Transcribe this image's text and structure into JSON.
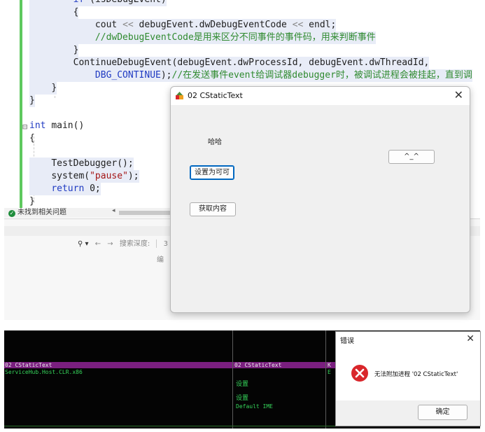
{
  "editor": {
    "lines": [
      {
        "indent": "        ",
        "parts": [
          {
            "t": "if ",
            "c": "kw"
          },
          {
            "t": "(",
            "c": "pl"
          },
          {
            "t": "isDebugEvent",
            "c": "pl"
          },
          {
            "t": ")",
            "c": "pl"
          }
        ]
      },
      {
        "indent": "        ",
        "parts": [
          {
            "t": "{",
            "c": "pl"
          }
        ]
      },
      {
        "indent": "            ",
        "parts": [
          {
            "t": "cout ",
            "c": "pl"
          },
          {
            "t": "<<",
            "c": "dim"
          },
          {
            "t": " debugEvent.dwDebugEventCode ",
            "c": "pl"
          },
          {
            "t": "<<",
            "c": "dim"
          },
          {
            "t": " endl;",
            "c": "pl"
          }
        ]
      },
      {
        "indent": "            ",
        "parts": [
          {
            "t": "//dwDebugEventCode是用来区分不同事件的事件码，用来判断事件",
            "c": "cm"
          }
        ]
      },
      {
        "indent": "        ",
        "parts": [
          {
            "t": "}",
            "c": "pl"
          }
        ]
      },
      {
        "indent": "        ",
        "parts": [
          {
            "t": "ContinueDebugEvent(debugEvent.dwProcessId, debugEvent.dwThreadId,",
            "c": "pl"
          }
        ]
      },
      {
        "indent": "            ",
        "parts": [
          {
            "t": "DBG_CONTINUE",
            "c": "kw"
          },
          {
            "t": ");",
            "c": "pl"
          },
          {
            "t": "//在发送事件event给调试器debugger时，被调试进程会被挂起，直到调",
            "c": "cm"
          }
        ]
      },
      {
        "indent": "    ",
        "parts": [
          {
            "t": "}",
            "c": "pl"
          }
        ]
      },
      {
        "indent": "",
        "parts": [
          {
            "t": "}",
            "c": "pl"
          }
        ]
      },
      {
        "indent": "",
        "parts": []
      },
      {
        "indent": "",
        "parts": [
          {
            "t": "int ",
            "c": "kw"
          },
          {
            "t": "main()",
            "c": "pl"
          }
        ]
      },
      {
        "indent": "",
        "parts": [
          {
            "t": "{",
            "c": "pl"
          }
        ]
      },
      {
        "indent": "",
        "parts": []
      },
      {
        "indent": "    ",
        "parts": [
          {
            "t": "TestDebugger();",
            "c": "pl"
          }
        ]
      },
      {
        "indent": "    ",
        "parts": [
          {
            "t": "system(",
            "c": "pl"
          },
          {
            "t": "\"pause\"",
            "c": "str"
          },
          {
            "t": ");",
            "c": "pl"
          }
        ]
      },
      {
        "indent": "    ",
        "parts": [
          {
            "t": "return ",
            "c": "kw"
          },
          {
            "t": "0;",
            "c": "pl"
          }
        ]
      },
      {
        "indent": "",
        "parts": [
          {
            "t": "}",
            "c": "pl"
          }
        ]
      }
    ]
  },
  "status": {
    "issues_text": "未找到相关问题"
  },
  "find_bar": {
    "search_glyph": "⚲ ▾",
    "back_arrow": "←",
    "forward_arrow": "→",
    "depth_label": "搜索深度:",
    "depth_value": "3",
    "column_header": "编"
  },
  "dialog": {
    "title": "02 CStaticText",
    "close_glyph": "✕",
    "static_text": "哈哈",
    "button_set_clickable": "设置为可可",
    "button_get_content": "获取内容",
    "button_emoticon": "^_^"
  },
  "black_panel": {
    "row1_left": "02 CStaticText",
    "row2_left": "ServiceHub.Host.CLR.x86",
    "row1_mid": "02 CStaticText",
    "row1_right": "K",
    "row2_right": "E",
    "mid_line_a": "设置",
    "mid_line_b": "设置",
    "mid_line_c": "Default IME"
  },
  "error_dialog": {
    "title": "错误",
    "close_glyph": "✕",
    "message": "无法附加进程 '02 CStaticText'",
    "ok_label": "确定"
  },
  "colors": {
    "accent_blue": "#0067c0",
    "error_red": "#d9262b",
    "code_green": "#5ec95e",
    "purple_row": "#7a1f7f"
  }
}
